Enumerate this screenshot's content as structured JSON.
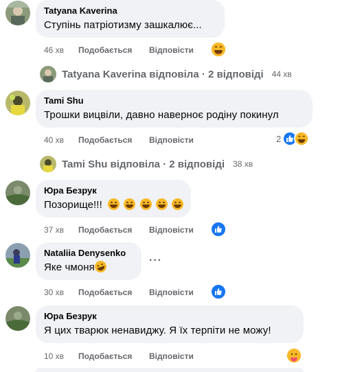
{
  "comments": [
    {
      "author": "Tatyana Kaverina",
      "text": "Ступінь патріотизму зашкалює...",
      "time": "46 хв",
      "like": "Подобається",
      "reply": "Відповісти",
      "reaction": "haha-emoji",
      "replies_summary": {
        "label": "Tatyana Kaverina відповіла · 2 відповіді",
        "time": "44 хв"
      }
    },
    {
      "author": "Tami Shu",
      "text": "Трошки вицвіли, давно навернoє родіну покинул",
      "time": "40 хв",
      "like": "Подобається",
      "reply": "Відповісти",
      "reaction_count": "2",
      "reaction": "like-haha",
      "replies_summary": {
        "label": "Tami Shu відповіла · 2 відповіді",
        "time": "38 хв"
      }
    },
    {
      "author": "Юра Безрук",
      "text": "Позорище!!!",
      "time": "37 хв",
      "like": "Подобається",
      "reply": "Відповісти",
      "reaction": "like"
    },
    {
      "author": "Nataliia Denysenko",
      "text": "Яке чмоня",
      "time": "30 хв",
      "like": "Подобається",
      "reply": "Відповісти",
      "reaction": "like"
    },
    {
      "author": "Юра Безрук",
      "text": "Я цих тварюк ненавиджу. Я їх терпіти не можу!",
      "time": "10 хв",
      "like": "Подобається",
      "reply": "Відповісти",
      "reaction": "care-emoji"
    }
  ],
  "colors": {
    "bubble": "#f0f2f5",
    "secondary_text": "#65676b",
    "like_blue": "#1877f2",
    "emoji_yellow": "#f7b928"
  }
}
